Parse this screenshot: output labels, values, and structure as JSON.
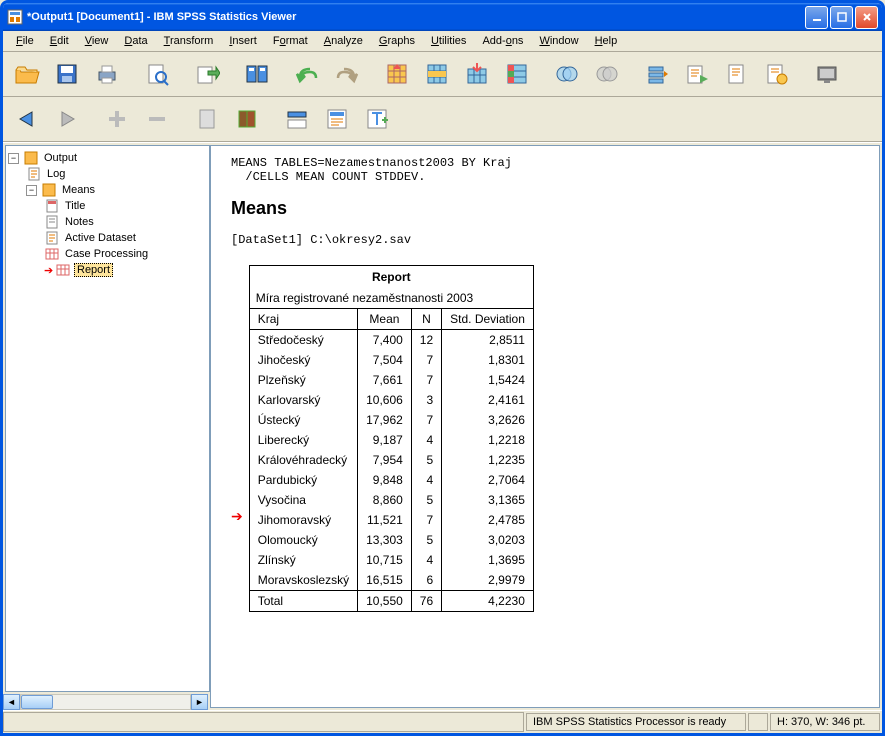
{
  "window": {
    "title": "*Output1 [Document1] - IBM SPSS Statistics Viewer"
  },
  "menu": {
    "file": "File",
    "edit": "Edit",
    "view": "View",
    "data": "Data",
    "transform": "Transform",
    "insert": "Insert",
    "format": "Format",
    "analyze": "Analyze",
    "graphs": "Graphs",
    "utilities": "Utilities",
    "addons": "Add-ons",
    "window": "Window",
    "help": "Help"
  },
  "tree": {
    "root": "Output",
    "log": "Log",
    "means": "Means",
    "title": "Title",
    "notes": "Notes",
    "active": "Active Dataset",
    "case": "Case Processing",
    "report": "Report"
  },
  "output": {
    "syntax_line1": "MEANS TABLES=Nezamestnanost2003 BY Kraj",
    "syntax_line2": "  /CELLS MEAN COUNT STDDEV.",
    "means_heading": "Means",
    "dataset": "[DataSet1] C:\\okresy2.sav",
    "report_title": "Report",
    "report_sub": "Míra registrované nezaměstnanosti 2003",
    "col_kraj": "Kraj",
    "col_mean": "Mean",
    "col_n": "N",
    "col_std": "Std. Deviation",
    "rows": [
      {
        "k": "Středočeský",
        "m": "7,400",
        "n": "12",
        "s": "2,8511"
      },
      {
        "k": "Jihočeský",
        "m": "7,504",
        "n": "7",
        "s": "1,8301"
      },
      {
        "k": "Plzeňský",
        "m": "7,661",
        "n": "7",
        "s": "1,5424"
      },
      {
        "k": "Karlovarský",
        "m": "10,606",
        "n": "3",
        "s": "2,4161"
      },
      {
        "k": "Ústecký",
        "m": "17,962",
        "n": "7",
        "s": "3,2626"
      },
      {
        "k": "Liberecký",
        "m": "9,187",
        "n": "4",
        "s": "1,2218"
      },
      {
        "k": "Královéhradecký",
        "m": "7,954",
        "n": "5",
        "s": "1,2235"
      },
      {
        "k": "Pardubický",
        "m": "9,848",
        "n": "4",
        "s": "2,7064"
      },
      {
        "k": "Vysočina",
        "m": "8,860",
        "n": "5",
        "s": "3,1365"
      },
      {
        "k": "Jihomoravský",
        "m": "11,521",
        "n": "7",
        "s": "2,4785"
      },
      {
        "k": "Olomoucký",
        "m": "13,303",
        "n": "5",
        "s": "3,0203"
      },
      {
        "k": "Zlínský",
        "m": "10,715",
        "n": "4",
        "s": "1,3695"
      },
      {
        "k": "Moravskoslezský",
        "m": "16,515",
        "n": "6",
        "s": "2,9979"
      }
    ],
    "total": {
      "k": "Total",
      "m": "10,550",
      "n": "76",
      "s": "4,2230"
    }
  },
  "status": {
    "processor": "IBM SPSS Statistics Processor is ready",
    "dims": "H: 370, W: 346 pt."
  }
}
